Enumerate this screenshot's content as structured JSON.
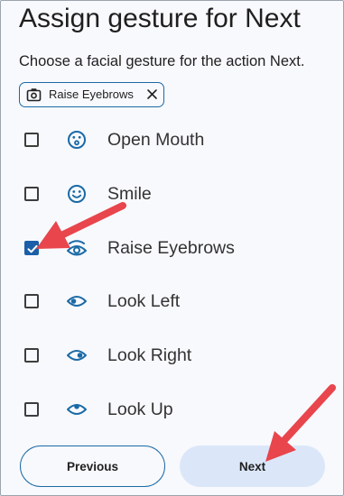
{
  "page": {
    "title": "Assign gesture for Next",
    "subtitle": "Choose a facial gesture for the action Next."
  },
  "chip": {
    "label": "Raise Eyebrows",
    "icon": "camera-icon",
    "close_icon": "close-icon"
  },
  "gestures": [
    {
      "label": "Open Mouth",
      "checked": false,
      "icon": "open-mouth-face-icon"
    },
    {
      "label": "Smile",
      "checked": false,
      "icon": "smile-face-icon"
    },
    {
      "label": "Raise Eyebrows",
      "checked": true,
      "icon": "raised-eyebrow-eye-icon"
    },
    {
      "label": "Look Left",
      "checked": false,
      "icon": "look-left-eye-icon"
    },
    {
      "label": "Look Right",
      "checked": false,
      "icon": "look-right-eye-icon"
    },
    {
      "label": "Look Up",
      "checked": false,
      "icon": "look-up-eye-icon"
    }
  ],
  "buttons": {
    "previous": "Previous",
    "next": "Next"
  },
  "colors": {
    "accent": "#1b5fa8",
    "icon": "#1a6aa6",
    "next_button_bg": "#dbe7f9",
    "annotation_arrow": "#e8454c"
  }
}
